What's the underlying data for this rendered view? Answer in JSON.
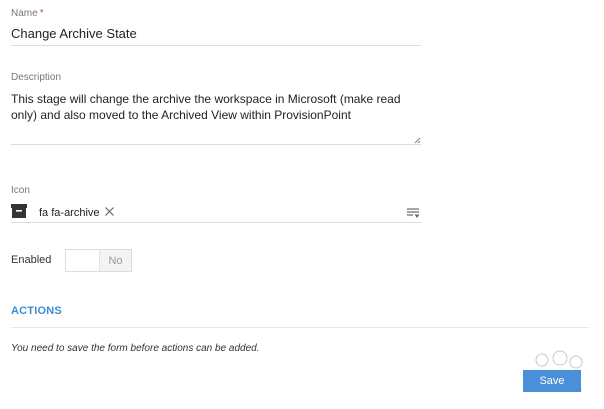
{
  "form": {
    "name": {
      "label": "Name",
      "required_marker": "*",
      "value": "Change Archive State"
    },
    "description": {
      "label": "Description",
      "value": "This stage will change the archive the workspace in Microsoft (make read only) and also moved to the Archived View within ProvisionPoint"
    },
    "icon": {
      "label": "Icon",
      "value": "fa fa-archive",
      "icon_name": "archive-icon"
    },
    "enabled": {
      "label": "Enabled",
      "state_text": "No",
      "checked": false
    }
  },
  "actions": {
    "heading": "ACTIONS",
    "note": "You need to save the form before actions can be added."
  },
  "footer": {
    "save_label": "Save"
  },
  "colors": {
    "accent": "#3a8ed4",
    "button": "#4a90d9",
    "required": "#d9534f"
  }
}
